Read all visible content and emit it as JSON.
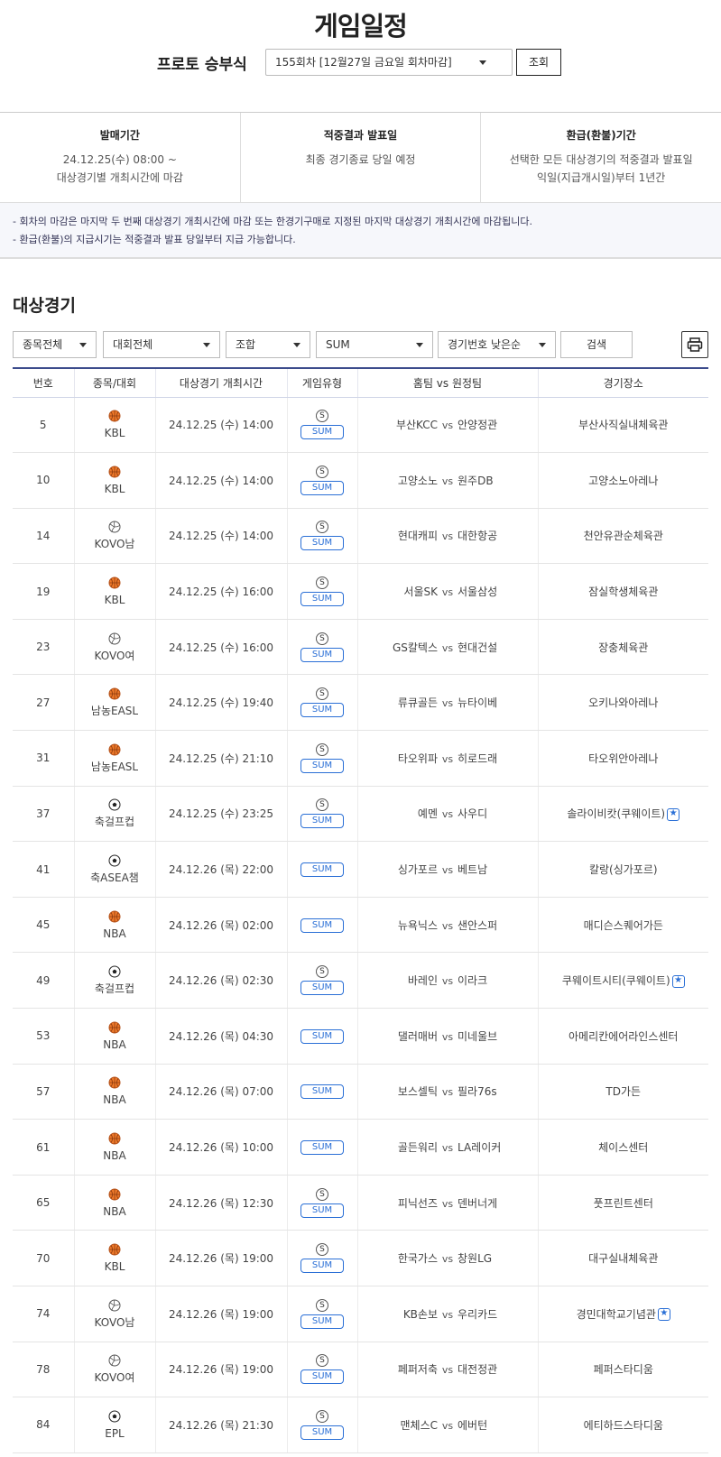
{
  "header": {
    "title": "게임일정",
    "round_label": "프로토 승부식",
    "round_select": "155회차 [12월27일 금요일 회차마감]",
    "search_button": "조회"
  },
  "info": [
    {
      "title": "발매기간",
      "lines": [
        "24.12.25(수) 08:00 ~",
        "대상경기별 개최시간에 마감"
      ]
    },
    {
      "title": "적중결과 발표일",
      "lines": [
        "최종 경기종료 당일 예정",
        ""
      ]
    },
    {
      "title": "환급(환불)기간",
      "lines": [
        "선택한 모든 대상경기의 적중결과 발표일",
        "익일(지급개시일)부터 1년간"
      ]
    }
  ],
  "notice": [
    "- 회차의 마감은 마지막 두 번째 대상경기 개최시간에 마감 또는 한경기구매로 지정된 마지막 대상경기 개최시간에 마감됩니다.",
    "- 환급(환불)의 지급시기는 적중결과 발표 당일부터 지급 가능합니다."
  ],
  "section_title": "대상경기",
  "filters": {
    "sport": "종목전체",
    "league": "대회전체",
    "combo": "조합",
    "type": "SUM",
    "sort": "경기번호 낮은순",
    "search": "검색"
  },
  "table": {
    "headers": [
      "번호",
      "종목/대회",
      "대상경기 개최시간",
      "게임유형",
      "홈팀 vs 원정팀",
      "경기장소"
    ],
    "vs": "vs",
    "rows": [
      {
        "no": "5",
        "sport": "basketball",
        "league": "KBL",
        "time": "24.12.25 (수) 14:00",
        "s": true,
        "type": "SUM",
        "home": "부산KCC",
        "away": "안양정관",
        "venue": "부산사직실내체육관",
        "star": false
      },
      {
        "no": "10",
        "sport": "basketball",
        "league": "KBL",
        "time": "24.12.25 (수) 14:00",
        "s": true,
        "type": "SUM",
        "home": "고양소노",
        "away": "원주DB",
        "venue": "고양소노아레나",
        "star": false
      },
      {
        "no": "14",
        "sport": "volleyball",
        "league": "KOVO남",
        "time": "24.12.25 (수) 14:00",
        "s": true,
        "type": "SUM",
        "home": "현대캐피",
        "away": "대한항공",
        "venue": "천안유관순체육관",
        "star": false
      },
      {
        "no": "19",
        "sport": "basketball",
        "league": "KBL",
        "time": "24.12.25 (수) 16:00",
        "s": true,
        "type": "SUM",
        "home": "서울SK",
        "away": "서울삼성",
        "venue": "잠실학생체육관",
        "star": false
      },
      {
        "no": "23",
        "sport": "volleyball",
        "league": "KOVO여",
        "time": "24.12.25 (수) 16:00",
        "s": true,
        "type": "SUM",
        "home": "GS칼텍스",
        "away": "현대건설",
        "venue": "장충체육관",
        "star": false
      },
      {
        "no": "27",
        "sport": "basketball",
        "league": "남농EASL",
        "time": "24.12.25 (수) 19:40",
        "s": true,
        "type": "SUM",
        "home": "류큐골든",
        "away": "뉴타이베",
        "venue": "오키나와아레나",
        "star": false
      },
      {
        "no": "31",
        "sport": "basketball",
        "league": "남농EASL",
        "time": "24.12.25 (수) 21:10",
        "s": true,
        "type": "SUM",
        "home": "타오위파",
        "away": "히로드래",
        "venue": "타오위안아레나",
        "star": false
      },
      {
        "no": "37",
        "sport": "soccer",
        "league": "축걸프컵",
        "time": "24.12.25 (수) 23:25",
        "s": true,
        "type": "SUM",
        "home": "예멘",
        "away": "사우디",
        "venue": "솔라이비캇(쿠웨이트)",
        "star": true
      },
      {
        "no": "41",
        "sport": "soccer",
        "league": "축ASEA챔",
        "time": "24.12.26 (목) 22:00",
        "s": false,
        "type": "SUM",
        "home": "싱가포르",
        "away": "베트남",
        "venue": "칼랑(싱가포르)",
        "star": false
      },
      {
        "no": "45",
        "sport": "basketball",
        "league": "NBA",
        "time": "24.12.26 (목) 02:00",
        "s": false,
        "type": "SUM",
        "home": "뉴욕닉스",
        "away": "샌안스퍼",
        "venue": "매디슨스퀘어가든",
        "star": false
      },
      {
        "no": "49",
        "sport": "soccer",
        "league": "축걸프컵",
        "time": "24.12.26 (목) 02:30",
        "s": true,
        "type": "SUM",
        "home": "바레인",
        "away": "이라크",
        "venue": "쿠웨이트시티(쿠웨이트)",
        "star": true
      },
      {
        "no": "53",
        "sport": "basketball",
        "league": "NBA",
        "time": "24.12.26 (목) 04:30",
        "s": false,
        "type": "SUM",
        "home": "댈러매버",
        "away": "미네울브",
        "venue": "아메리칸에어라인스센터",
        "star": false
      },
      {
        "no": "57",
        "sport": "basketball",
        "league": "NBA",
        "time": "24.12.26 (목) 07:00",
        "s": false,
        "type": "SUM",
        "home": "보스셀틱",
        "away": "필라76s",
        "venue": "TD가든",
        "star": false
      },
      {
        "no": "61",
        "sport": "basketball",
        "league": "NBA",
        "time": "24.12.26 (목) 10:00",
        "s": false,
        "type": "SUM",
        "home": "골든워리",
        "away": "LA레이커",
        "venue": "체이스센터",
        "star": false
      },
      {
        "no": "65",
        "sport": "basketball",
        "league": "NBA",
        "time": "24.12.26 (목) 12:30",
        "s": true,
        "type": "SUM",
        "home": "피닉선즈",
        "away": "덴버너게",
        "venue": "풋프린트센터",
        "star": false
      },
      {
        "no": "70",
        "sport": "basketball",
        "league": "KBL",
        "time": "24.12.26 (목) 19:00",
        "s": true,
        "type": "SUM",
        "home": "한국가스",
        "away": "창원LG",
        "venue": "대구실내체육관",
        "star": false
      },
      {
        "no": "74",
        "sport": "volleyball",
        "league": "KOVO남",
        "time": "24.12.26 (목) 19:00",
        "s": true,
        "type": "SUM",
        "home": "KB손보",
        "away": "우리카드",
        "venue": "경민대학교기념관",
        "star": true
      },
      {
        "no": "78",
        "sport": "volleyball",
        "league": "KOVO여",
        "time": "24.12.26 (목) 19:00",
        "s": true,
        "type": "SUM",
        "home": "페퍼저축",
        "away": "대전정관",
        "venue": "페퍼스타디움",
        "star": false
      },
      {
        "no": "84",
        "sport": "soccer",
        "league": "EPL",
        "time": "24.12.26 (목) 21:30",
        "s": true,
        "type": "SUM",
        "home": "맨체스C",
        "away": "에버턴",
        "venue": "에티하드스타디움",
        "star": false
      }
    ]
  }
}
